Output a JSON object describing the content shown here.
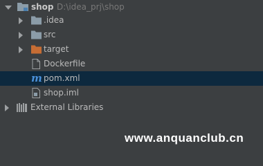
{
  "tree": {
    "root": {
      "name": "shop",
      "path": "D:\\idea_prj\\shop",
      "icon": "folder-module-icon"
    },
    "items": [
      {
        "label": ".idea",
        "icon": "folder-icon"
      },
      {
        "label": "src",
        "icon": "folder-icon"
      },
      {
        "label": "target",
        "icon": "folder-excluded-icon"
      },
      {
        "label": "Dockerfile",
        "icon": "file-icon"
      },
      {
        "label": "pom.xml",
        "icon": "maven-icon"
      },
      {
        "label": "shop.iml",
        "icon": "iml-file-icon"
      }
    ],
    "libraries": {
      "label": "External Libraries",
      "icon": "library-icon"
    }
  },
  "watermark": "www.anquanclub.cn",
  "colors": {
    "background": "#3c3f41",
    "selected_row": "#0d293e",
    "folder": "#8b9ca8",
    "excluded_folder": "#c66d34",
    "text": "#bbbbbb"
  }
}
